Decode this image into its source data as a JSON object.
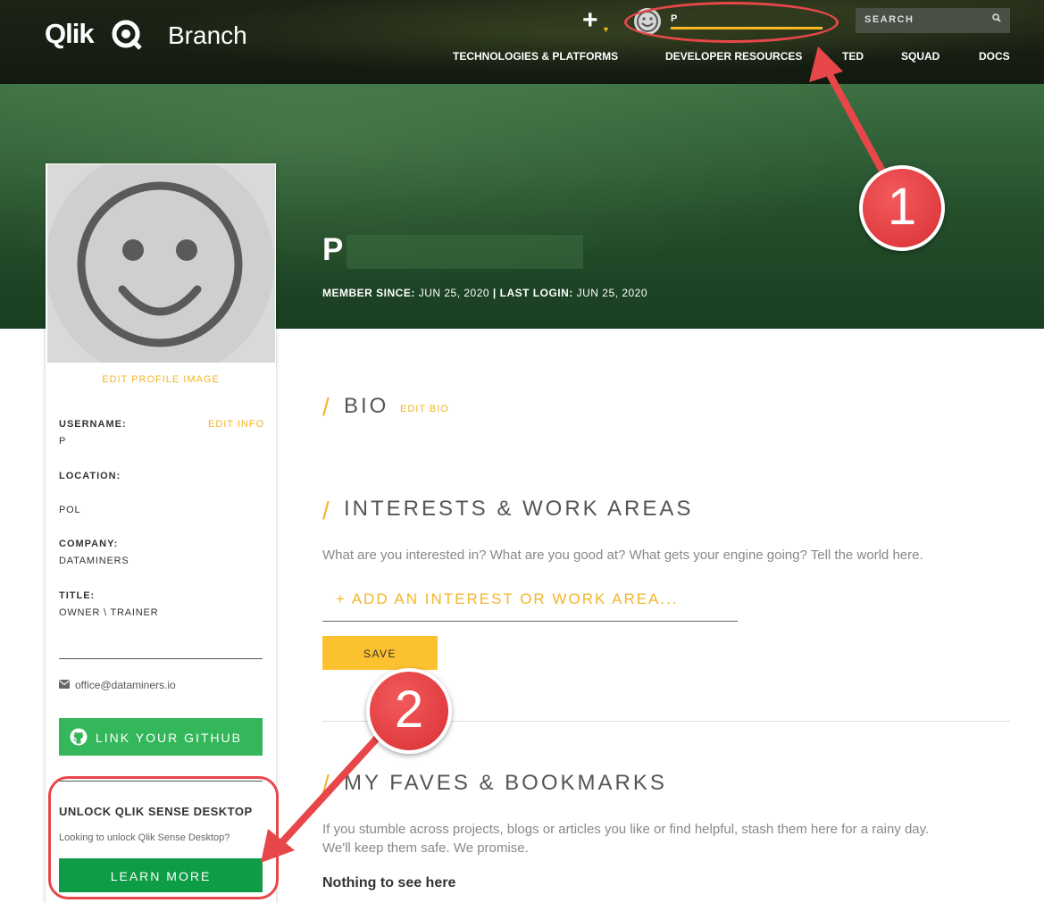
{
  "header": {
    "logo": "Qlik",
    "brand": "Branch",
    "user_name": "P",
    "search_label": "SEARCH",
    "nav": [
      "TECHNOLOGIES & PLATFORMS",
      "DEVELOPER RESOURCES",
      "TED",
      "SQUAD",
      "DOCS"
    ]
  },
  "profile": {
    "name": "P",
    "member_since_label": "MEMBER SINCE:",
    "member_since_value": "JUN 25, 2020",
    "separator": "|",
    "last_login_label": "LAST LOGIN:",
    "last_login_value": "JUN 25, 2020"
  },
  "sidebar": {
    "edit_image": "EDIT PROFILE IMAGE",
    "edit_info": "EDIT INFO",
    "username_label": "USERNAME:",
    "username_value": "P",
    "location_label": "LOCATION:",
    "location_value": "POL",
    "company_label": "COMPANY:",
    "company_value": "DATAMINERS",
    "title_label": "TITLE:",
    "title_value": "OWNER \\ TRAINER",
    "email": "office@dataminers.io",
    "github_button": "LINK YOUR GITHUB",
    "unlock_title": "UNLOCK QLIK SENSE DESKTOP",
    "unlock_sub": "Looking to unlock Qlik Sense Desktop?",
    "learn_more": "LEARN MORE"
  },
  "main": {
    "slash": "/",
    "bio_title": "BIO",
    "edit_bio": "EDIT BIO",
    "interests_title": "INTERESTS & WORK AREAS",
    "interests_desc": "What are you interested in? What are you good at? What gets your engine going? Tell the world here.",
    "add_interest": "+ ADD AN INTEREST OR WORK AREA...",
    "save": "SAVE",
    "faves_title": "MY FAVES & BOOKMARKS",
    "faves_desc": "If you stumble across projects, blogs or articles you like or find helpful, stash them here for a rainy day. We'll keep them safe. We promise.",
    "nothing": "Nothing to see here"
  },
  "annotations": {
    "badge_1": "1",
    "badge_2": "2",
    "color": "#e8474a"
  },
  "colors": {
    "accent": "#f2b52a",
    "github_green": "#34b65a",
    "learn_green": "#0e9c46",
    "save_yellow": "#fcc12e"
  }
}
